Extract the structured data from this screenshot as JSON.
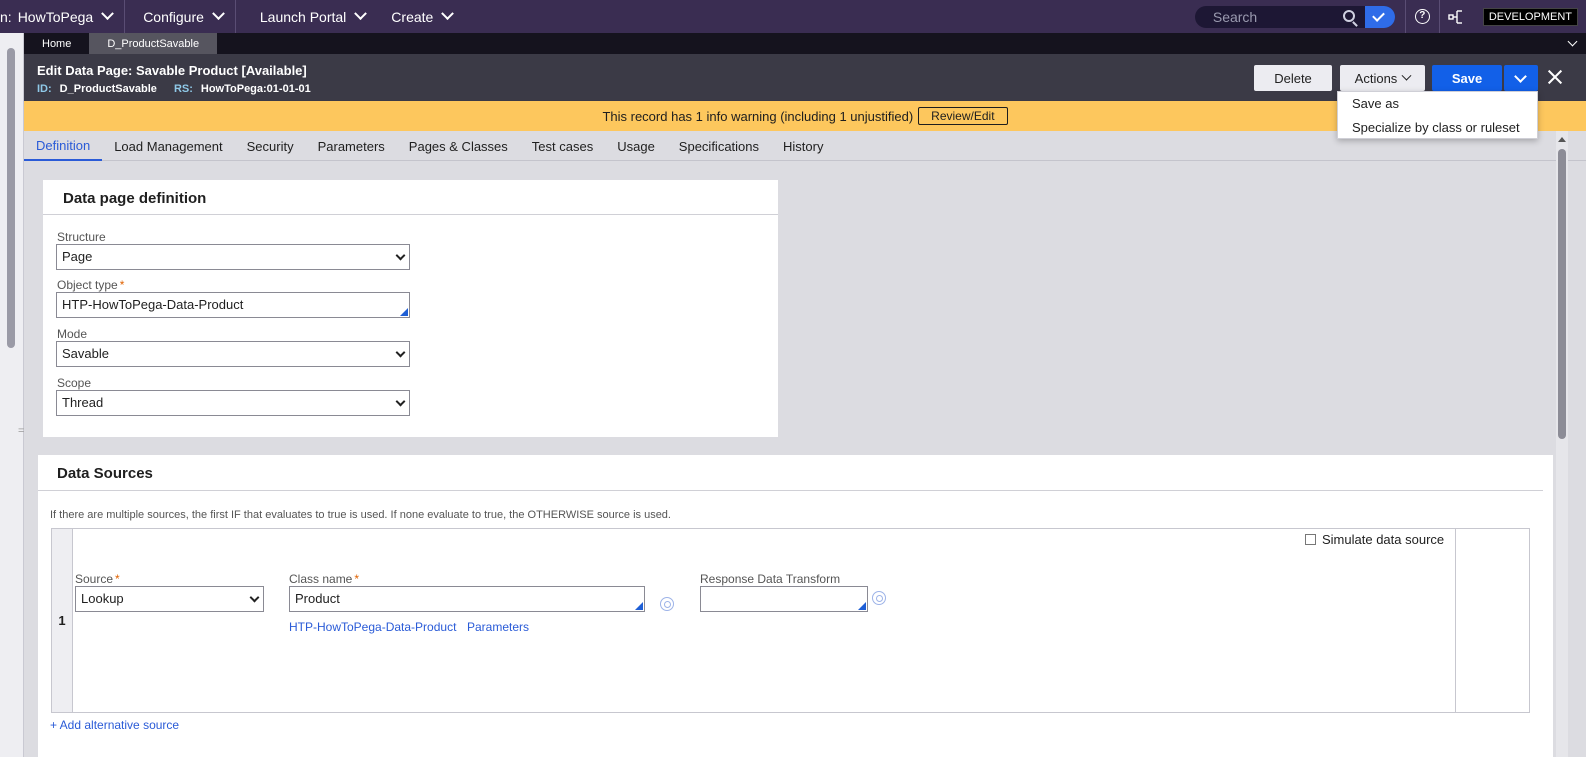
{
  "topbar": {
    "app_prefix": "n:",
    "app_name": "HowToPega",
    "menus": [
      "Configure",
      "Launch Portal",
      "Create"
    ],
    "search_placeholder": "Search",
    "environment_badge": "DEVELOPMENT"
  },
  "tabs": [
    {
      "label": "Home",
      "active": false
    },
    {
      "label": "D_ProductSavable",
      "active": true
    }
  ],
  "record": {
    "title_prefix": "Edit",
    "title": "Data Page: Savable Product",
    "status": "[Available]",
    "id_label": "ID:",
    "id_value": "D_ProductSavable",
    "rs_label": "RS:",
    "rs_value": "HowToPega:01-01-01"
  },
  "buttons": {
    "delete": "Delete",
    "actions": "Actions",
    "save": "Save"
  },
  "save_menu": [
    "Save as",
    "Specialize by class or ruleset"
  ],
  "warning": {
    "text": "This record has 1 info warning (including 1 unjustified)",
    "button": "Review/Edit"
  },
  "nav_tabs": [
    {
      "label": "Definition",
      "active": true
    },
    {
      "label": "Load Management",
      "active": false
    },
    {
      "label": "Security",
      "active": false
    },
    {
      "label": "Parameters",
      "active": false
    },
    {
      "label": "Pages & Classes",
      "active": false
    },
    {
      "label": "Test cases",
      "active": false
    },
    {
      "label": "Usage",
      "active": false
    },
    {
      "label": "Specifications",
      "active": false
    },
    {
      "label": "History",
      "active": false
    }
  ],
  "definition": {
    "title": "Data page definition",
    "structure_label": "Structure",
    "structure_value": "Page",
    "object_type_label": "Object type",
    "object_type_value": "HTP-HowToPega-Data-Product",
    "mode_label": "Mode",
    "mode_value": "Savable",
    "scope_label": "Scope",
    "scope_value": "Thread"
  },
  "sources": {
    "title": "Data Sources",
    "hint": "If there are multiple sources, the first IF that evaluates to true is used. If none evaluate to true, the OTHERWISE source is used.",
    "row_number": "1",
    "simulate_label": "Simulate data source",
    "simulate_checked": false,
    "source_label": "Source",
    "source_value": "Lookup",
    "class_label": "Class name",
    "class_value": "Product",
    "class_link": "HTP-HowToPega-Data-Product",
    "params_link": "Parameters",
    "response_label": "Response Data Transform",
    "response_value": "",
    "add_link": "+ Add alternative source"
  },
  "colors": {
    "topbar": "#3a2d52",
    "header": "#3b3a46",
    "warning": "#fdc75d",
    "accent": "#1260e8",
    "link": "#2a5bd7"
  }
}
